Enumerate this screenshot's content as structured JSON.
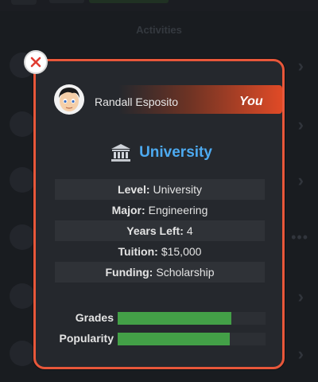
{
  "background": {
    "section_title": "Activities"
  },
  "modal": {
    "user": {
      "name": "Randall Esposito",
      "tag": "You"
    },
    "school": {
      "icon": "bank-icon",
      "title": "University"
    },
    "info": [
      {
        "label": "Level:",
        "value": "University"
      },
      {
        "label": "Major:",
        "value": "Engineering"
      },
      {
        "label": "Years Left:",
        "value": "4"
      },
      {
        "label": "Tuition:",
        "value": "$15,000"
      },
      {
        "label": "Funding:",
        "value": "Scholarship"
      }
    ],
    "stats": [
      {
        "label": "Grades",
        "fraction": 0.77
      },
      {
        "label": "Popularity",
        "fraction": 0.76
      }
    ]
  },
  "colors": {
    "accent": "#e8573a",
    "title_blue": "#4daaf0",
    "bar_green": "#43a047",
    "close_x": "#e03c31"
  }
}
